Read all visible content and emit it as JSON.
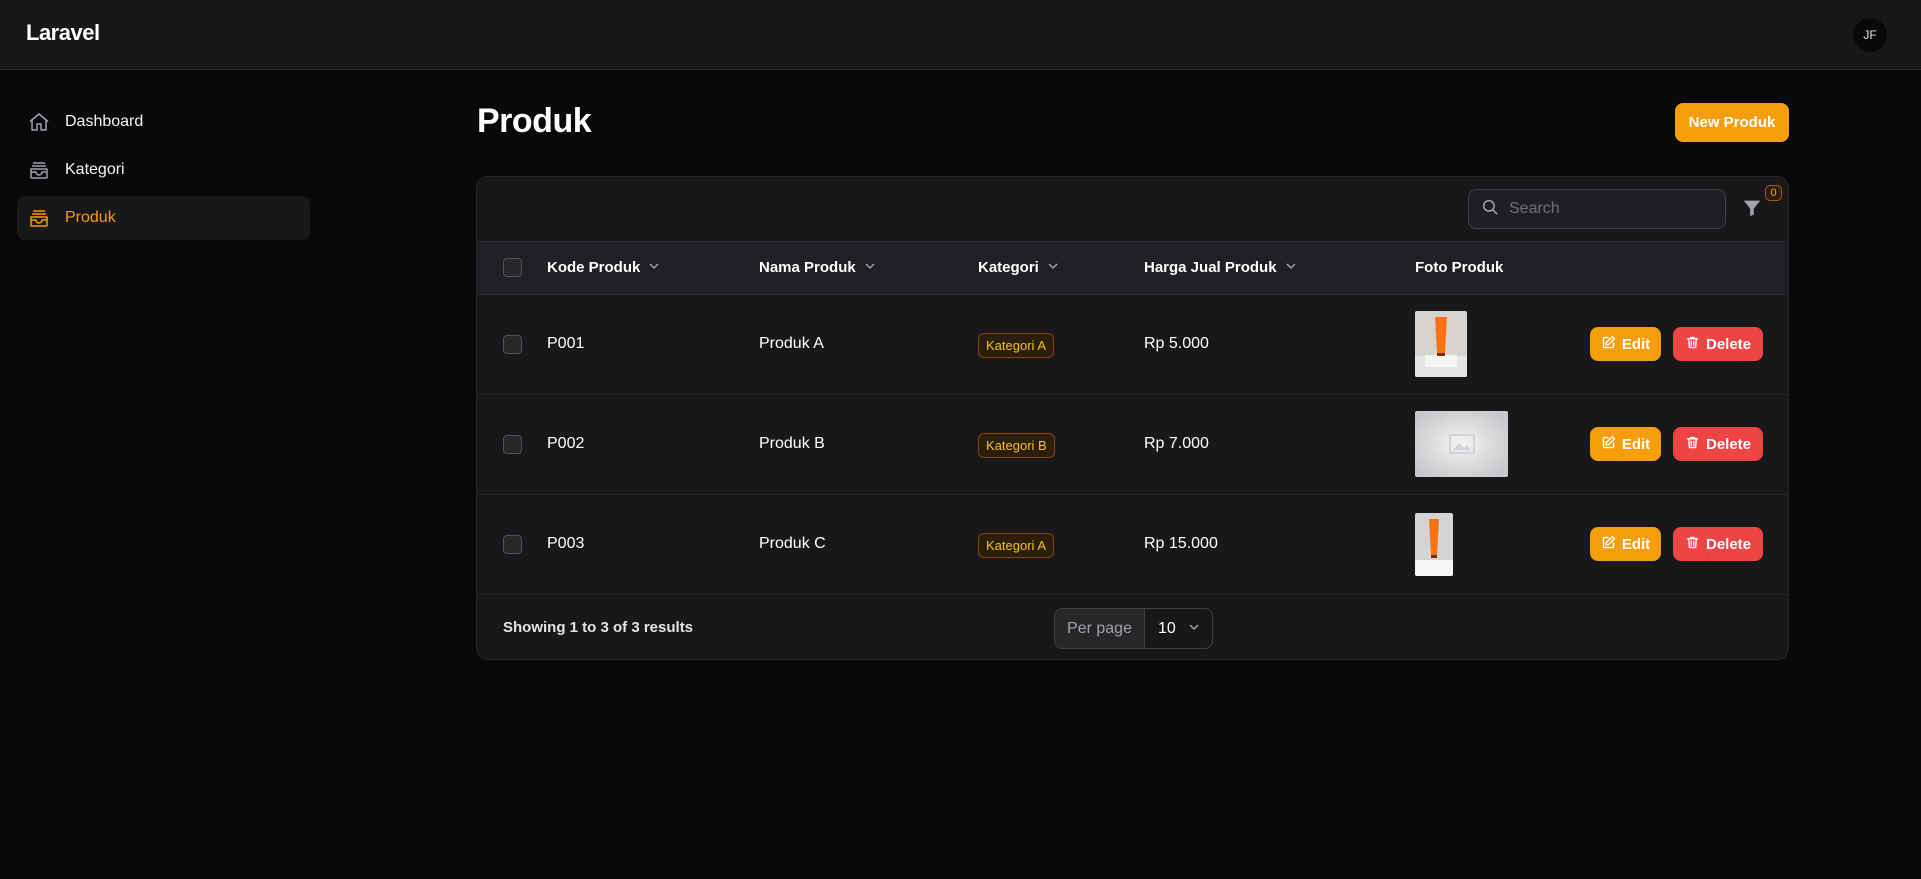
{
  "app": {
    "brand": "Laravel",
    "avatar_initials": "JF"
  },
  "sidebar": {
    "items": [
      {
        "label": "Dashboard",
        "icon": "home-icon",
        "active": false
      },
      {
        "label": "Kategori",
        "icon": "inbox-stack-icon",
        "active": false
      },
      {
        "label": "Produk",
        "icon": "inbox-stack-icon",
        "active": true
      }
    ]
  },
  "page": {
    "title": "Produk",
    "new_button": "New Produk"
  },
  "search": {
    "placeholder": "Search",
    "value": ""
  },
  "filter": {
    "count": "0",
    "icon": "funnel-icon"
  },
  "table": {
    "columns": [
      {
        "label": "Kode Produk",
        "sortable": true
      },
      {
        "label": "Nama Produk",
        "sortable": true
      },
      {
        "label": "Kategori",
        "sortable": true
      },
      {
        "label": "Harga Jual Produk",
        "sortable": true
      },
      {
        "label": "Foto Produk",
        "sortable": false
      }
    ],
    "rows": [
      {
        "kode": "P001",
        "nama": "Produk A",
        "kategori": "Kategori A",
        "harga": "Rp 5.000",
        "foto": "tube-product-photo"
      },
      {
        "kode": "P002",
        "nama": "Produk B",
        "kategori": "Kategori B",
        "harga": "Rp 7.000",
        "foto": "placeholder-image"
      },
      {
        "kode": "P003",
        "nama": "Produk C",
        "kategori": "Kategori A",
        "harga": "Rp 15.000",
        "foto": "tube-product-photo"
      }
    ],
    "actions": {
      "edit": "Edit",
      "delete": "Delete"
    }
  },
  "pagination": {
    "summary": "Showing 1 to 3 of 3 results",
    "per_page_label": "Per page",
    "per_page_value": "10"
  },
  "colors": {
    "accent": "#f59e0b",
    "danger": "#ef4444",
    "background": "#09090b",
    "surface": "#18181b"
  }
}
